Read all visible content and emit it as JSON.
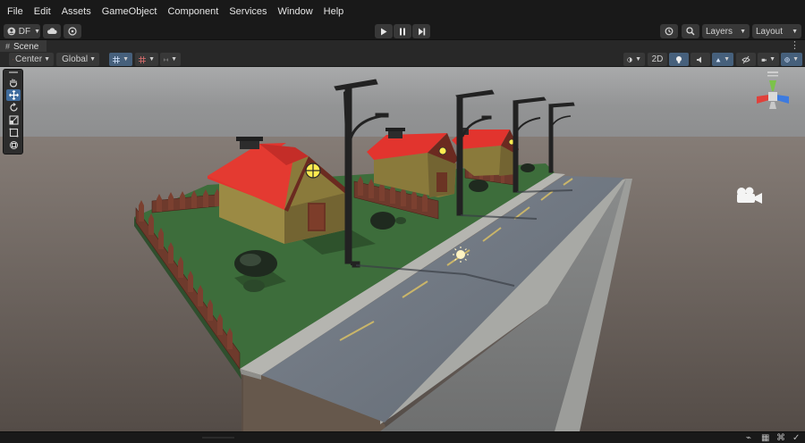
{
  "menubar": {
    "items": [
      "File",
      "Edit",
      "Assets",
      "GameObject",
      "Component",
      "Services",
      "Window",
      "Help"
    ]
  },
  "toolbar": {
    "account_label": "DF",
    "layers_label": "Layers",
    "layout_label": "Layout"
  },
  "scene_tab": {
    "label": "Scene"
  },
  "scene_toolbar": {
    "pivot_label": "Center",
    "space_label": "Global",
    "mode_2d_label": "2D"
  },
  "icons": {
    "account": "account-circle-icon",
    "cloud": "cloud-icon",
    "collab": "collab-icon",
    "play": "play-icon",
    "pause": "pause-icon",
    "step": "step-icon",
    "history": "history-icon",
    "search": "search-icon",
    "hand": "hand-tool-icon",
    "move": "move-tool-icon",
    "rotate": "rotate-tool-icon",
    "scale": "scale-tool-icon",
    "rect": "rect-tool-icon",
    "transform": "transform-tool-icon",
    "camera_gizmo": "camera-gizmo-icon",
    "sun_gizmo": "sun-gizmo-icon"
  },
  "colors": {
    "menubar_bg": "#191919",
    "panel_bg": "#282828",
    "button_bg": "#383838",
    "active_blue": "#3f6c9e",
    "roof_red": "#e2342e",
    "grass_green": "#3a6b3a",
    "house_wall": "#8b7a3c",
    "road_gray": "#6f767f",
    "sidewalk_gray": "#a6a6a0"
  }
}
